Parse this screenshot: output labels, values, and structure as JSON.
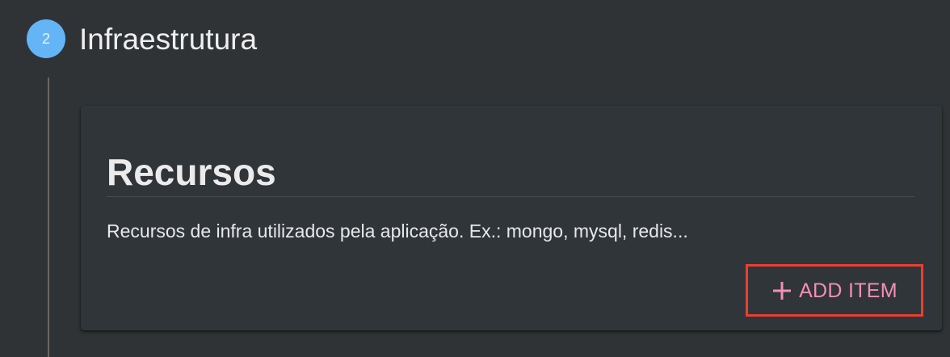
{
  "stepper": {
    "step_number": "2",
    "step_title": "Infraestrutura"
  },
  "card": {
    "title": "Recursos",
    "description": "Recursos de infra utilizados pela aplicação. Ex.: mongo, mysql, redis...",
    "add_button_label": "ADD ITEM",
    "add_button_icon": "plus-icon"
  },
  "colors": {
    "background": "#2f3336",
    "step_circle": "#64b5f6",
    "accent_pink": "#f48fb1",
    "highlight_border": "#e8402f"
  }
}
